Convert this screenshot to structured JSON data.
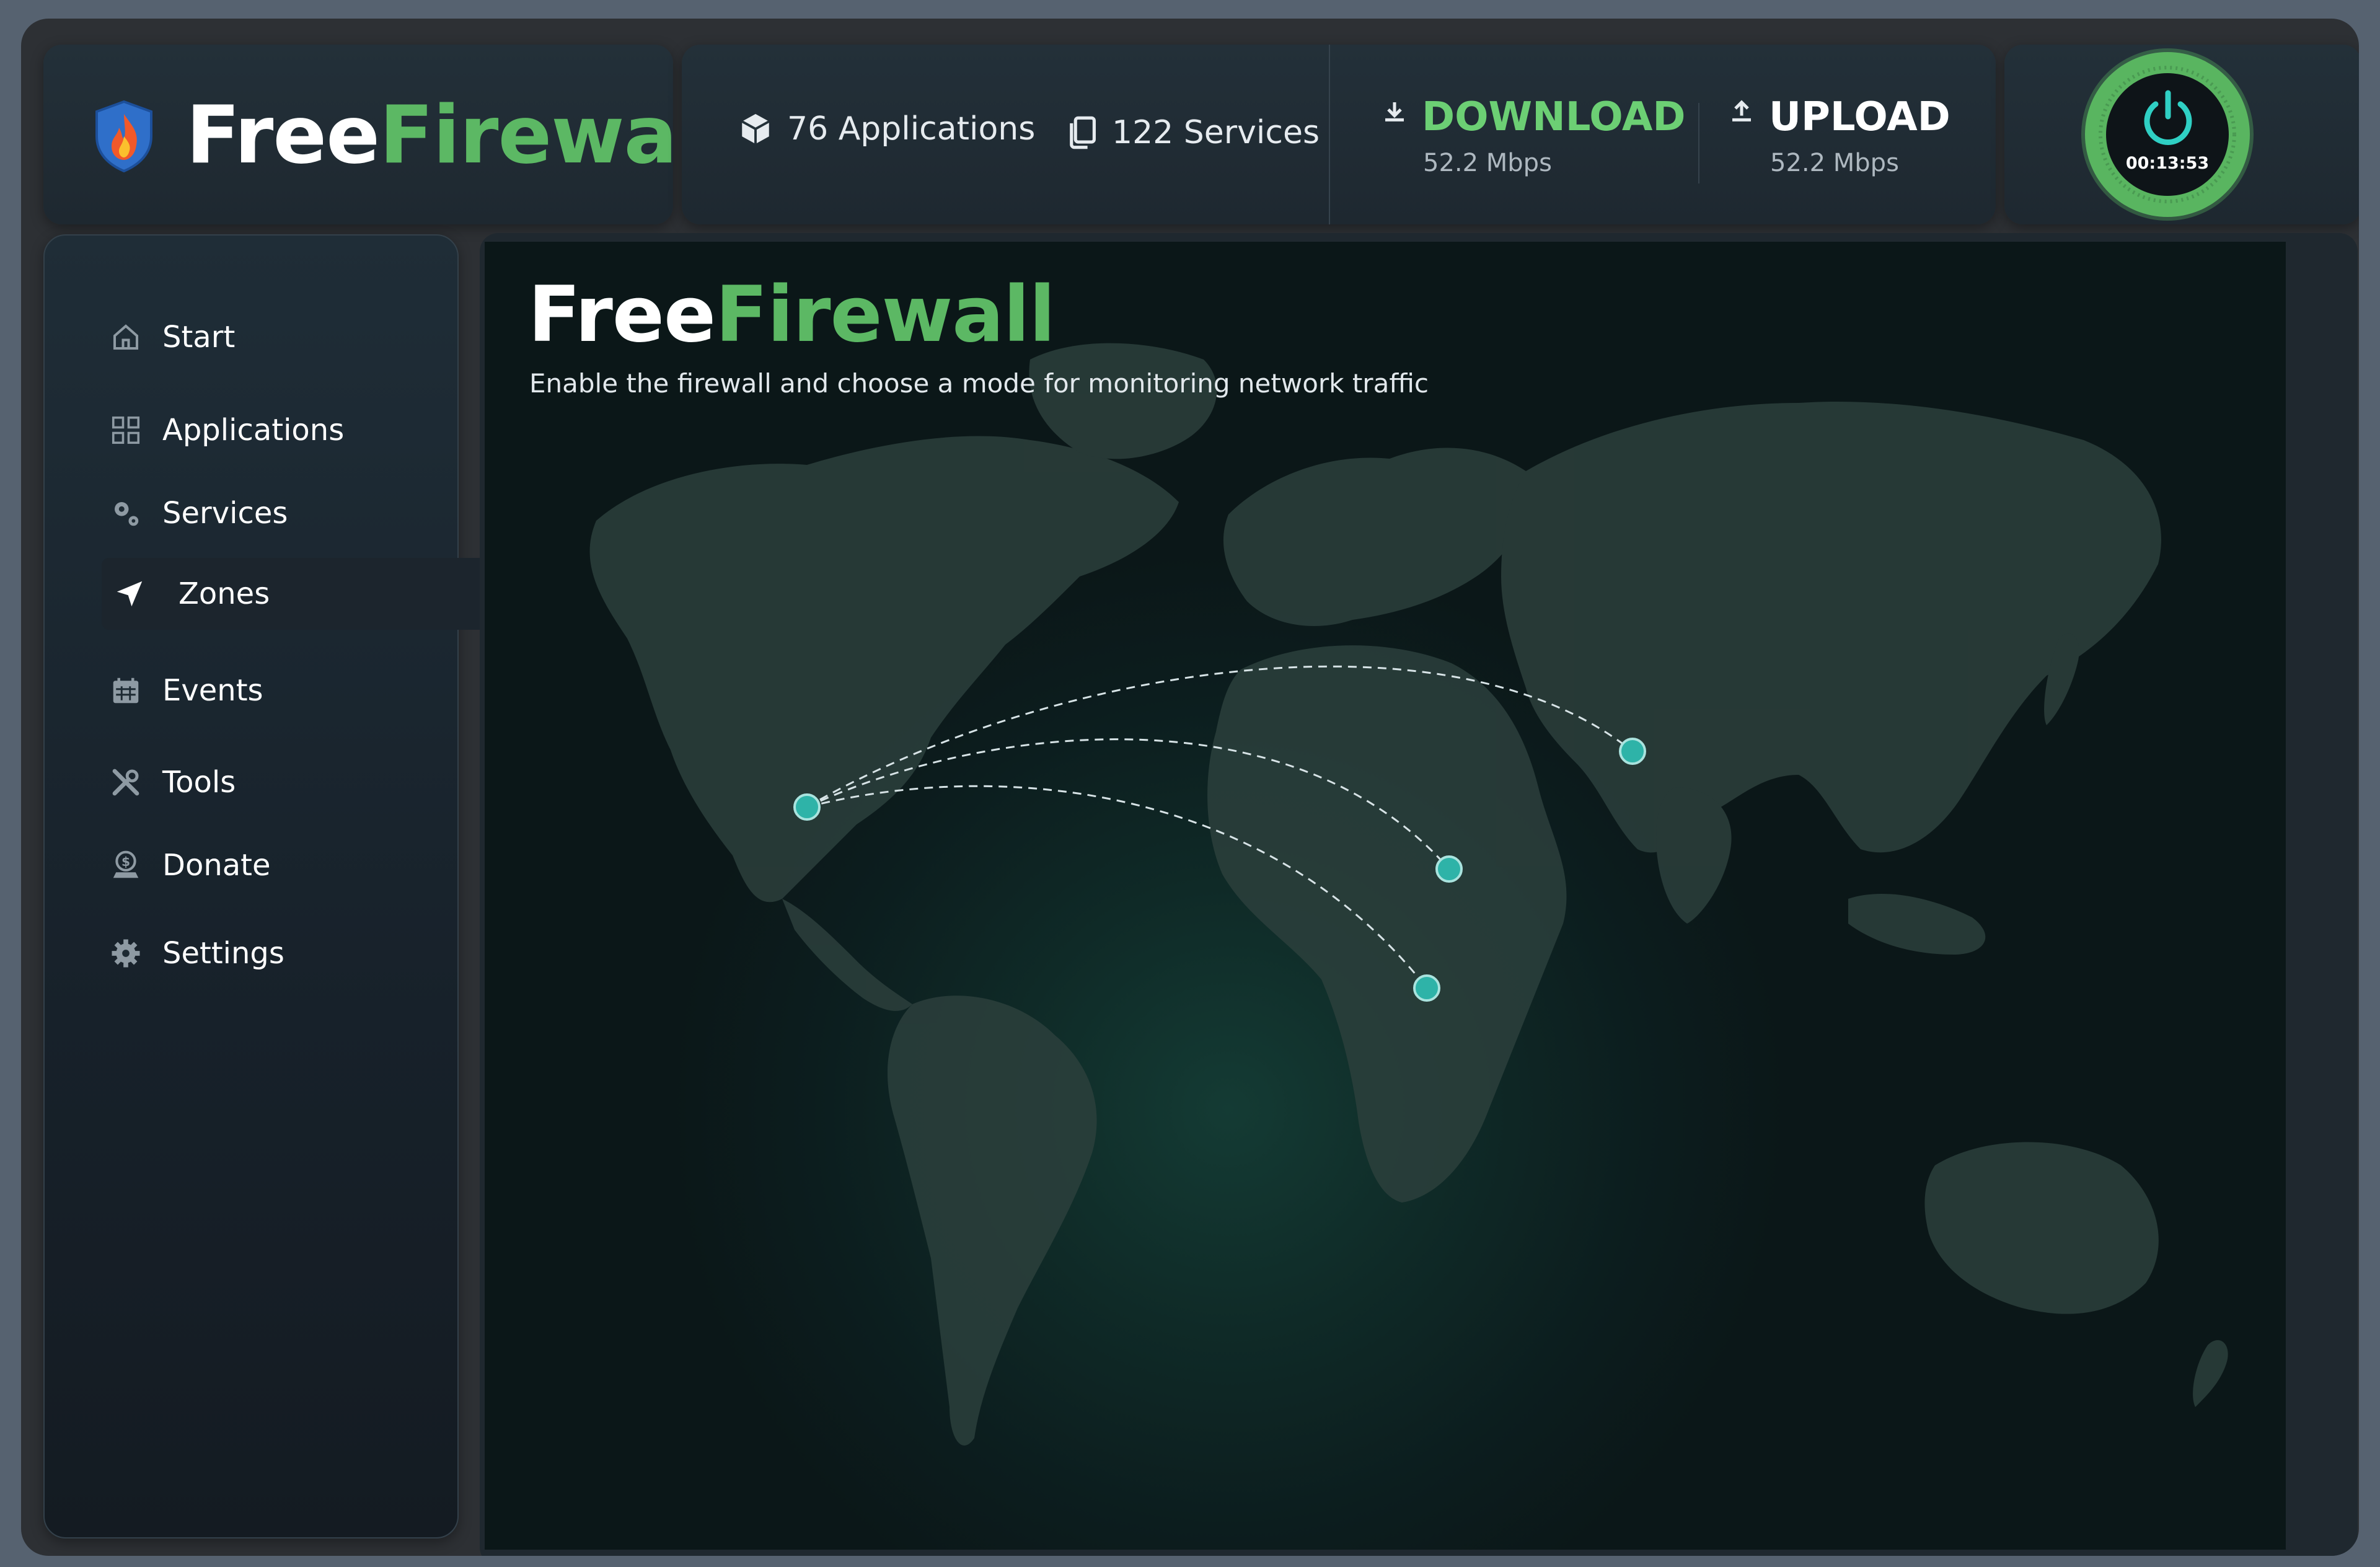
{
  "app": {
    "brand_white": "Free",
    "brand_green": "Firewall"
  },
  "header": {
    "applications_label": "76 Applications",
    "services_label": "122 Services",
    "download": {
      "title": "DOWNLOAD",
      "value": "52.2 Mbps"
    },
    "upload": {
      "title": "UPLOAD",
      "value": "52.2 Mbps"
    },
    "power": {
      "timer": "00:13:53",
      "state": "on"
    }
  },
  "sidebar": {
    "items": [
      {
        "label": "Start",
        "icon": "home-icon"
      },
      {
        "label": "Applications",
        "icon": "grid-icon"
      },
      {
        "label": "Services",
        "icon": "gears-icon"
      },
      {
        "label": "Zones",
        "icon": "navigation-arrow-icon",
        "active": true
      },
      {
        "label": "Events",
        "icon": "calendar-icon"
      },
      {
        "label": "Tools",
        "icon": "tools-icon"
      },
      {
        "label": "Donate",
        "icon": "donate-icon"
      },
      {
        "label": "Settings",
        "icon": "gear-icon"
      }
    ]
  },
  "main": {
    "title_white": "Free",
    "title_green": "Firewall",
    "subtitle": "Enable the firewall and choose a mode for monitoring network traffic"
  },
  "colors": {
    "accent_green": "#5cb864",
    "download_green": "#6ccf74",
    "node_teal": "#2eb3a8",
    "background": "#2d3034"
  }
}
